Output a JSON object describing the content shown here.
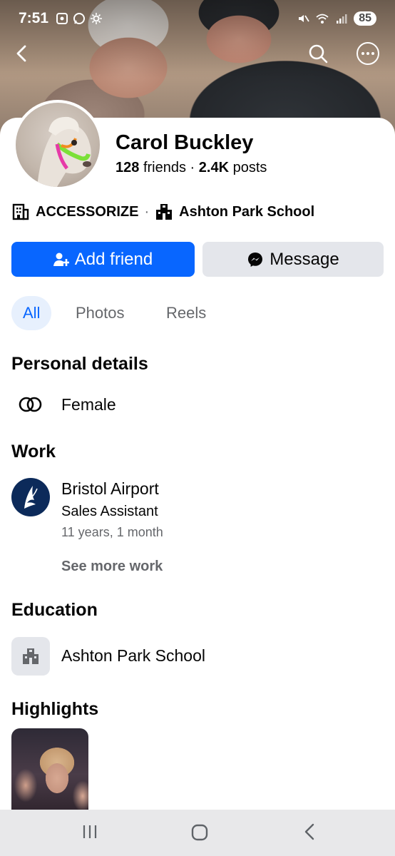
{
  "status_bar": {
    "time": "7:51",
    "battery": "85"
  },
  "profile": {
    "name": "Carol Buckley",
    "friends_count": "128",
    "friends_label": "friends",
    "separator": "·",
    "posts_count": "2.4K",
    "posts_label": "posts"
  },
  "affiliations": [
    {
      "label": "ACCESSORIZE",
      "icon": "building-icon"
    },
    {
      "label": "Ashton Park School",
      "icon": "school-icon"
    }
  ],
  "actions": {
    "add_friend": "Add friend",
    "message": "Message"
  },
  "tabs": [
    {
      "label": "All",
      "active": true
    },
    {
      "label": "Photos",
      "active": false
    },
    {
      "label": "Reels",
      "active": false
    }
  ],
  "personal_details": {
    "title": "Personal details",
    "gender": "Female"
  },
  "work": {
    "title": "Work",
    "employer": "Bristol Airport",
    "position": "Sales Assistant",
    "duration": "11 years, 1 month",
    "see_more": "See more work"
  },
  "education": {
    "title": "Education",
    "school": "Ashton Park School"
  },
  "highlights": {
    "title": "Highlights"
  },
  "colors": {
    "primary": "#0866ff",
    "secondary_button": "#e4e6eb",
    "tab_active_bg": "#e7f0fd",
    "muted_text": "#65676b"
  }
}
